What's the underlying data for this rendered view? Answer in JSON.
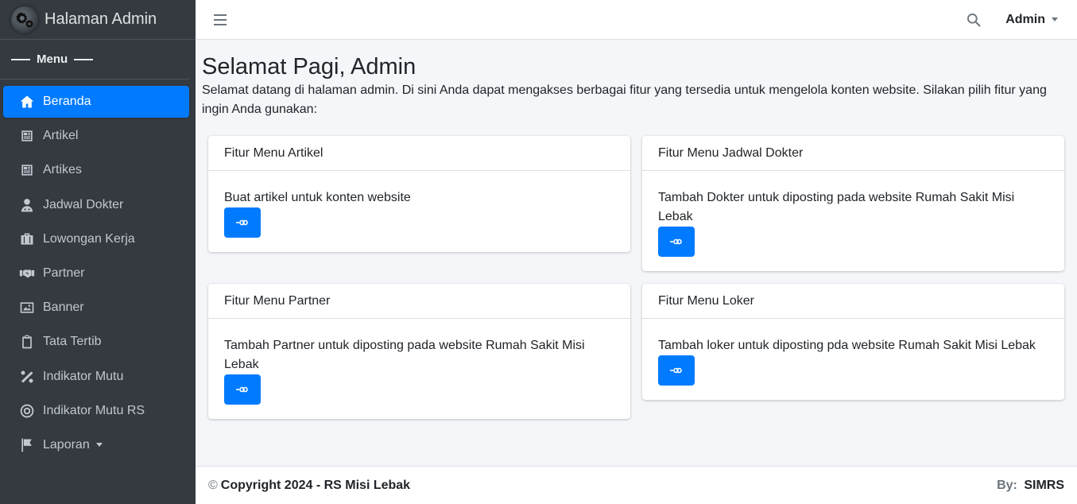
{
  "brand": {
    "title": "Halaman Admin",
    "logo_icon": "gears-icon"
  },
  "sidebar": {
    "menu_header": "Menu",
    "items": [
      {
        "label": "Beranda",
        "icon": "home-icon",
        "active": true
      },
      {
        "label": "Artikel",
        "icon": "newspaper-icon"
      },
      {
        "label": "Artikes",
        "icon": "newspaper-icon"
      },
      {
        "label": "Jadwal Dokter",
        "icon": "user-doctor-icon"
      },
      {
        "label": "Lowongan Kerja",
        "icon": "briefcase-icon"
      },
      {
        "label": "Partner",
        "icon": "handshake-icon"
      },
      {
        "label": "Banner",
        "icon": "image-icon"
      },
      {
        "label": "Tata Tertib",
        "icon": "clipboard-icon"
      },
      {
        "label": "Indikator Mutu",
        "icon": "percent-icon"
      },
      {
        "label": "Indikator Mutu RS",
        "icon": "bullseye-icon"
      },
      {
        "label": "Laporan",
        "icon": "flag-icon",
        "dropdown": true
      }
    ]
  },
  "navbar": {
    "user": "Admin"
  },
  "main": {
    "title": "Selamat Pagi, Admin",
    "description": "Selamat datang di halaman admin. Di sini Anda dapat mengakses berbagai fitur yang tersedia untuk mengelola konten website. Silakan pilih fitur yang ingin Anda gunakan:",
    "cards": [
      {
        "header": "Fitur Menu Artikel",
        "body": "Buat artikel untuk konten website"
      },
      {
        "header": "Fitur Menu Jadwal Dokter",
        "body": "Tambah Dokter untuk diposting pada website Rumah Sakit Misi Lebak"
      },
      {
        "header": "Fitur Menu Partner",
        "body": "Tambah Partner untuk diposting pada website Rumah Sakit Misi Lebak"
      },
      {
        "header": "Fitur Menu Loker",
        "body": "Tambah loker untuk diposting pda website Rumah Sakit Misi Lebak"
      }
    ]
  },
  "footer": {
    "copyright_symbol": "©",
    "copyright": "Copyright 2024 - RS Misi Lebak",
    "by_label": "By:",
    "by_value": "SIMRS"
  },
  "colors": {
    "primary": "#007bff",
    "sidebar": "#343a40"
  }
}
